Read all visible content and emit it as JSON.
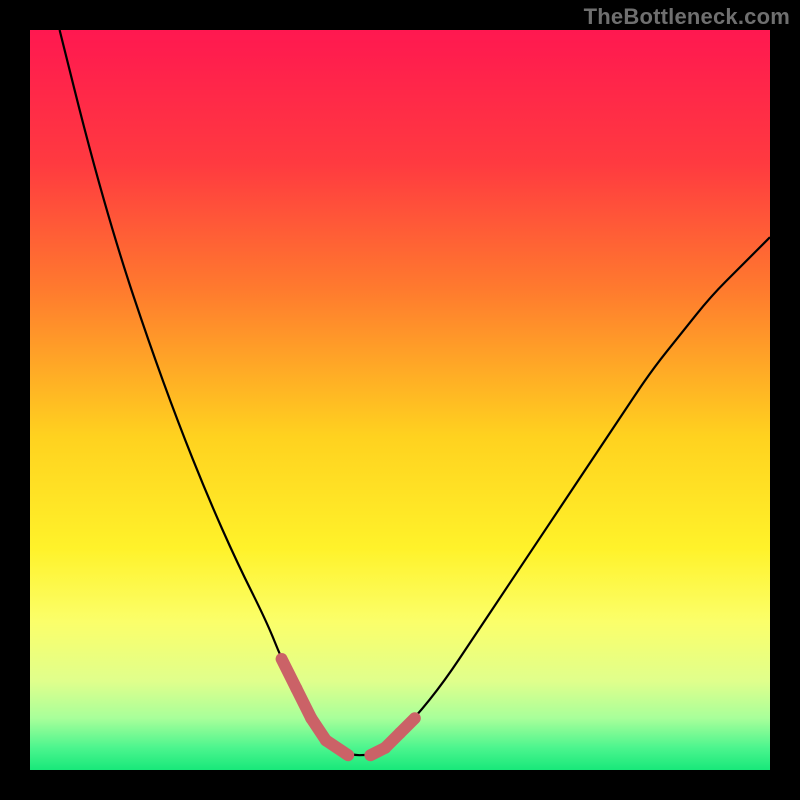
{
  "watermark": "TheBottleneck.com",
  "chart_data": {
    "type": "line",
    "title": "",
    "xlabel": "",
    "ylabel": "",
    "xlim": [
      0,
      100
    ],
    "ylim": [
      0,
      100
    ],
    "grid": false,
    "series": [
      {
        "name": "curve",
        "x": [
          4,
          8,
          12,
          16,
          20,
          24,
          28,
          32,
          34,
          36,
          38,
          40,
          43,
          46,
          48,
          52,
          56,
          60,
          64,
          68,
          72,
          76,
          80,
          84,
          88,
          92,
          96,
          100
        ],
        "y": [
          100,
          84,
          70,
          58,
          47,
          37,
          28,
          20,
          15,
          11,
          7,
          4,
          2,
          2,
          3,
          7,
          12,
          18,
          24,
          30,
          36,
          42,
          48,
          54,
          59,
          64,
          68,
          72
        ],
        "stroke": "#000000"
      }
    ],
    "annotations": [
      {
        "name": "bottom-marker-left",
        "type": "segments",
        "stroke": "#cb6267",
        "width": 12,
        "points": [
          [
            34,
            15
          ],
          [
            36,
            11
          ],
          [
            38,
            7
          ],
          [
            40,
            4
          ],
          [
            43,
            2
          ]
        ]
      },
      {
        "name": "bottom-marker-right",
        "type": "segments",
        "stroke": "#cb6267",
        "width": 12,
        "points": [
          [
            46,
            2
          ],
          [
            48,
            3
          ],
          [
            50,
            5
          ],
          [
            52,
            7
          ]
        ]
      }
    ],
    "gradient_stops": [
      {
        "offset": 0.0,
        "color": "#ff1850"
      },
      {
        "offset": 0.18,
        "color": "#ff3a40"
      },
      {
        "offset": 0.35,
        "color": "#ff7a2e"
      },
      {
        "offset": 0.55,
        "color": "#ffd21f"
      },
      {
        "offset": 0.7,
        "color": "#fff22a"
      },
      {
        "offset": 0.8,
        "color": "#fbff6a"
      },
      {
        "offset": 0.88,
        "color": "#e0ff8c"
      },
      {
        "offset": 0.93,
        "color": "#a8ff9a"
      },
      {
        "offset": 0.97,
        "color": "#4cf58e"
      },
      {
        "offset": 1.0,
        "color": "#18e87a"
      }
    ]
  }
}
